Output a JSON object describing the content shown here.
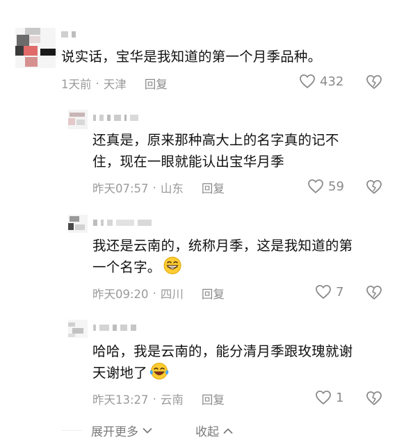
{
  "comments": [
    {
      "text": "说实话，宝华是我知道的第一个月季品种。",
      "time": "1天前",
      "location": "天津",
      "reply": "回复",
      "likes": "432"
    },
    {
      "text_line1": "还真是，原来那种高大上的名字真的记不",
      "text_line2": "住，现在一眼就能认出宝华月季",
      "time": "昨天07:57",
      "location": "山东",
      "reply": "回复",
      "likes": "59"
    },
    {
      "text_line1": "我还是云南的，统称月季，这是我知道的第",
      "text_line2": "一个名字。",
      "emoji": "grinning-emoji",
      "time": "昨天09:20",
      "location": "四川",
      "reply": "回复",
      "likes": "7"
    },
    {
      "text_line1": "哈哈，我是云南的，能分清月季跟玫瑰就谢",
      "text_line2": "天谢地了",
      "emoji": "tears-of-joy-emoji",
      "time": "昨天13:27",
      "location": "云南",
      "reply": "回复",
      "likes": "1"
    }
  ],
  "footer": {
    "expand": "展开更多",
    "collapse": "收起"
  },
  "separator": "·"
}
